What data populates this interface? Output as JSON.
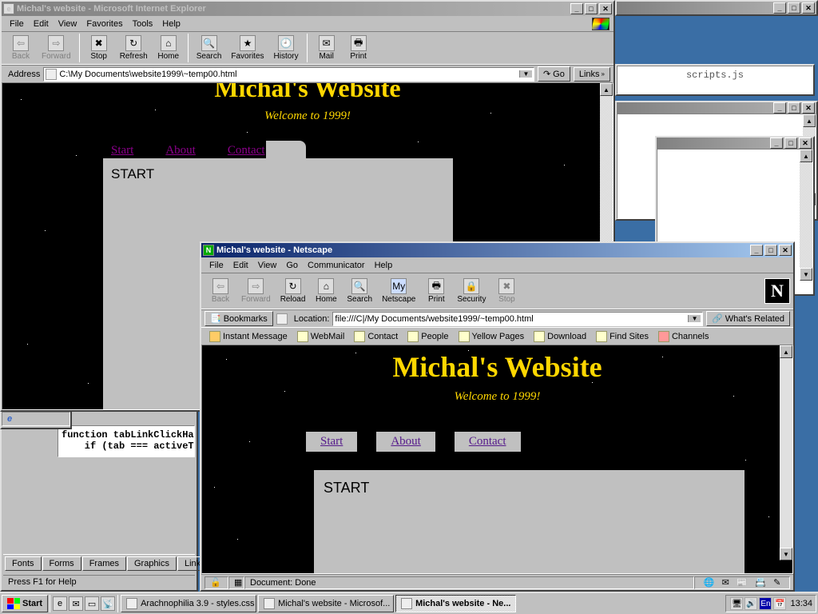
{
  "desktop": {
    "color": "#3a6ea5"
  },
  "ie": {
    "title": "Michal's website - Microsoft Internet Explorer",
    "menubar": [
      "File",
      "Edit",
      "View",
      "Favorites",
      "Tools",
      "Help"
    ],
    "toolbar": {
      "back": "Back",
      "forward": "Forward",
      "stop": "Stop",
      "refresh": "Refresh",
      "home": "Home",
      "search": "Search",
      "favorites": "Favorites",
      "history": "History",
      "mail": "Mail",
      "print": "Print"
    },
    "address": {
      "label": "Address",
      "url": "C:\\My Documents\\website1999\\~temp00.html",
      "go": "Go",
      "links": "Links"
    },
    "page": {
      "title": "Michal's Website",
      "subtitle": "Welcome to 1999!",
      "tabs": [
        "Start",
        "About",
        "Contact"
      ],
      "content_heading": "START"
    },
    "status_left": ""
  },
  "netscape": {
    "title": "Michal's website - Netscape",
    "menubar": [
      "File",
      "Edit",
      "View",
      "Go",
      "Communicator",
      "Help"
    ],
    "toolbar": {
      "back": "Back",
      "forward": "Forward",
      "reload": "Reload",
      "home": "Home",
      "search": "Search",
      "netscape": "Netscape",
      "print": "Print",
      "security": "Security",
      "stop": "Stop"
    },
    "bookmarks_label": "Bookmarks",
    "location_label": "Location:",
    "location_url": "file:///C|/My Documents/website1999/~temp00.html",
    "whats_related": "What's Related",
    "personal": [
      "Instant Message",
      "WebMail",
      "Contact",
      "People",
      "Yellow Pages",
      "Download",
      "Find Sites",
      "Channels"
    ],
    "page": {
      "title": "Michal's Website",
      "subtitle": "Welcome to 1999!",
      "tabs": [
        "Start",
        "About",
        "Contact"
      ],
      "content_heading": "START"
    },
    "status": "Document: Done"
  },
  "editor": {
    "tabs": [
      "Fonts",
      "Forms",
      "Frames",
      "Graphics",
      "Links"
    ],
    "helpline": "Press F1 for Help",
    "code": "function tabLinkClickHan\n    if (tab === activeTa"
  },
  "scripts_window": {
    "label": "scripts.js"
  },
  "taskbar": {
    "start": "Start",
    "tasks": [
      {
        "label": "Arachnophilia 3.9 - styles.css",
        "active": false
      },
      {
        "label": "Michal's website - Microsof...",
        "active": false
      },
      {
        "label": "Michal's website - Ne...",
        "active": true
      }
    ],
    "lang": "En",
    "clock": "13:34"
  }
}
